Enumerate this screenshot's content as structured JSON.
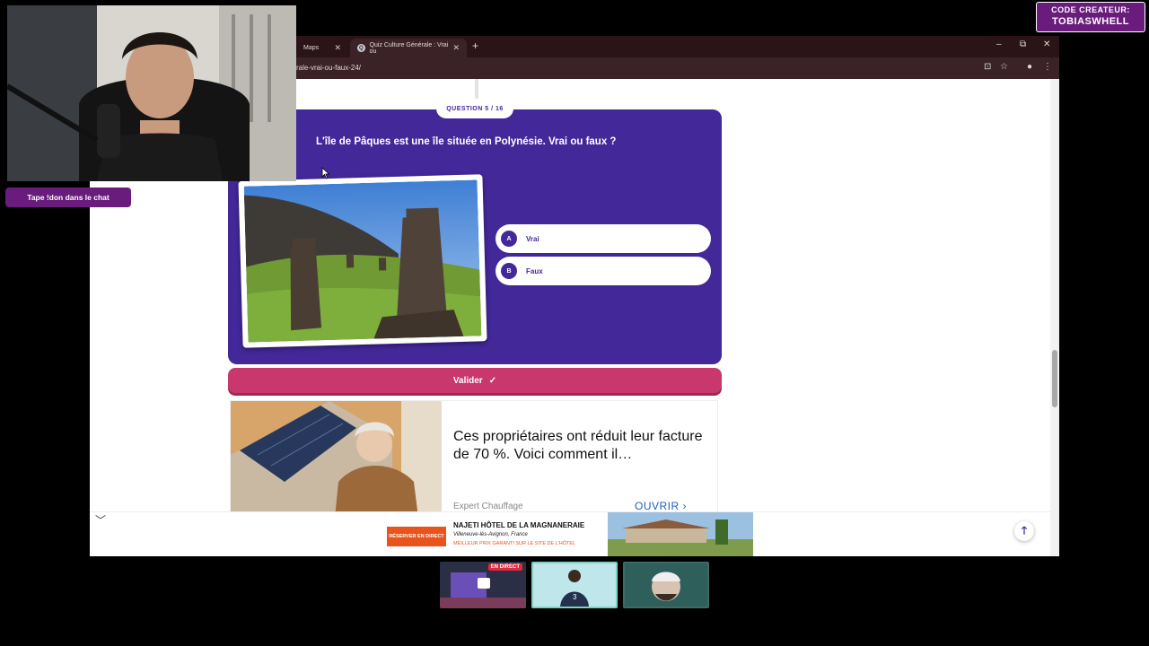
{
  "browser": {
    "tabs": [
      {
        "label": "Maps"
      },
      {
        "label": "Quiz Culture Générale : Vrai ou"
      }
    ],
    "url": "rale-vrai-ou-faux-24/"
  },
  "quiz": {
    "progress_label": "QUESTION 5 / 16",
    "question": "L'île de Pâques est une île située en Polynésie. Vrai ou faux ?",
    "answers": [
      {
        "letter": "A",
        "label": "Vrai"
      },
      {
        "letter": "B",
        "label": "Faux"
      }
    ],
    "validate_label": "Valider"
  },
  "ad": {
    "headline": "Ces propriétaires ont réduit leur facture de 70 %. Voici comment il…",
    "source": "Expert Chauffage",
    "cta": "OUVRIR"
  },
  "banner": {
    "button": "RÉSERVER EN DIRECT",
    "title": "NAJETI HÔTEL DE LA MAGNANERAIE",
    "location": "Villeneuve-lès-Avignon, France",
    "tagline": "MEILLEUR PRIX GARANTI SUR LE SITE DE L'HÔTEL"
  },
  "stream": {
    "chat_prompt": "Tape !don dans le chat",
    "creator_line1": "CODE CREATEUR:",
    "creator_line2": "TOBIASWHELL",
    "live_badge": "EN DIRECT"
  },
  "colors": {
    "quiz_purple": "#43289a",
    "validate_pink": "#c8386c",
    "stream_purple": "#6a1c7c"
  }
}
